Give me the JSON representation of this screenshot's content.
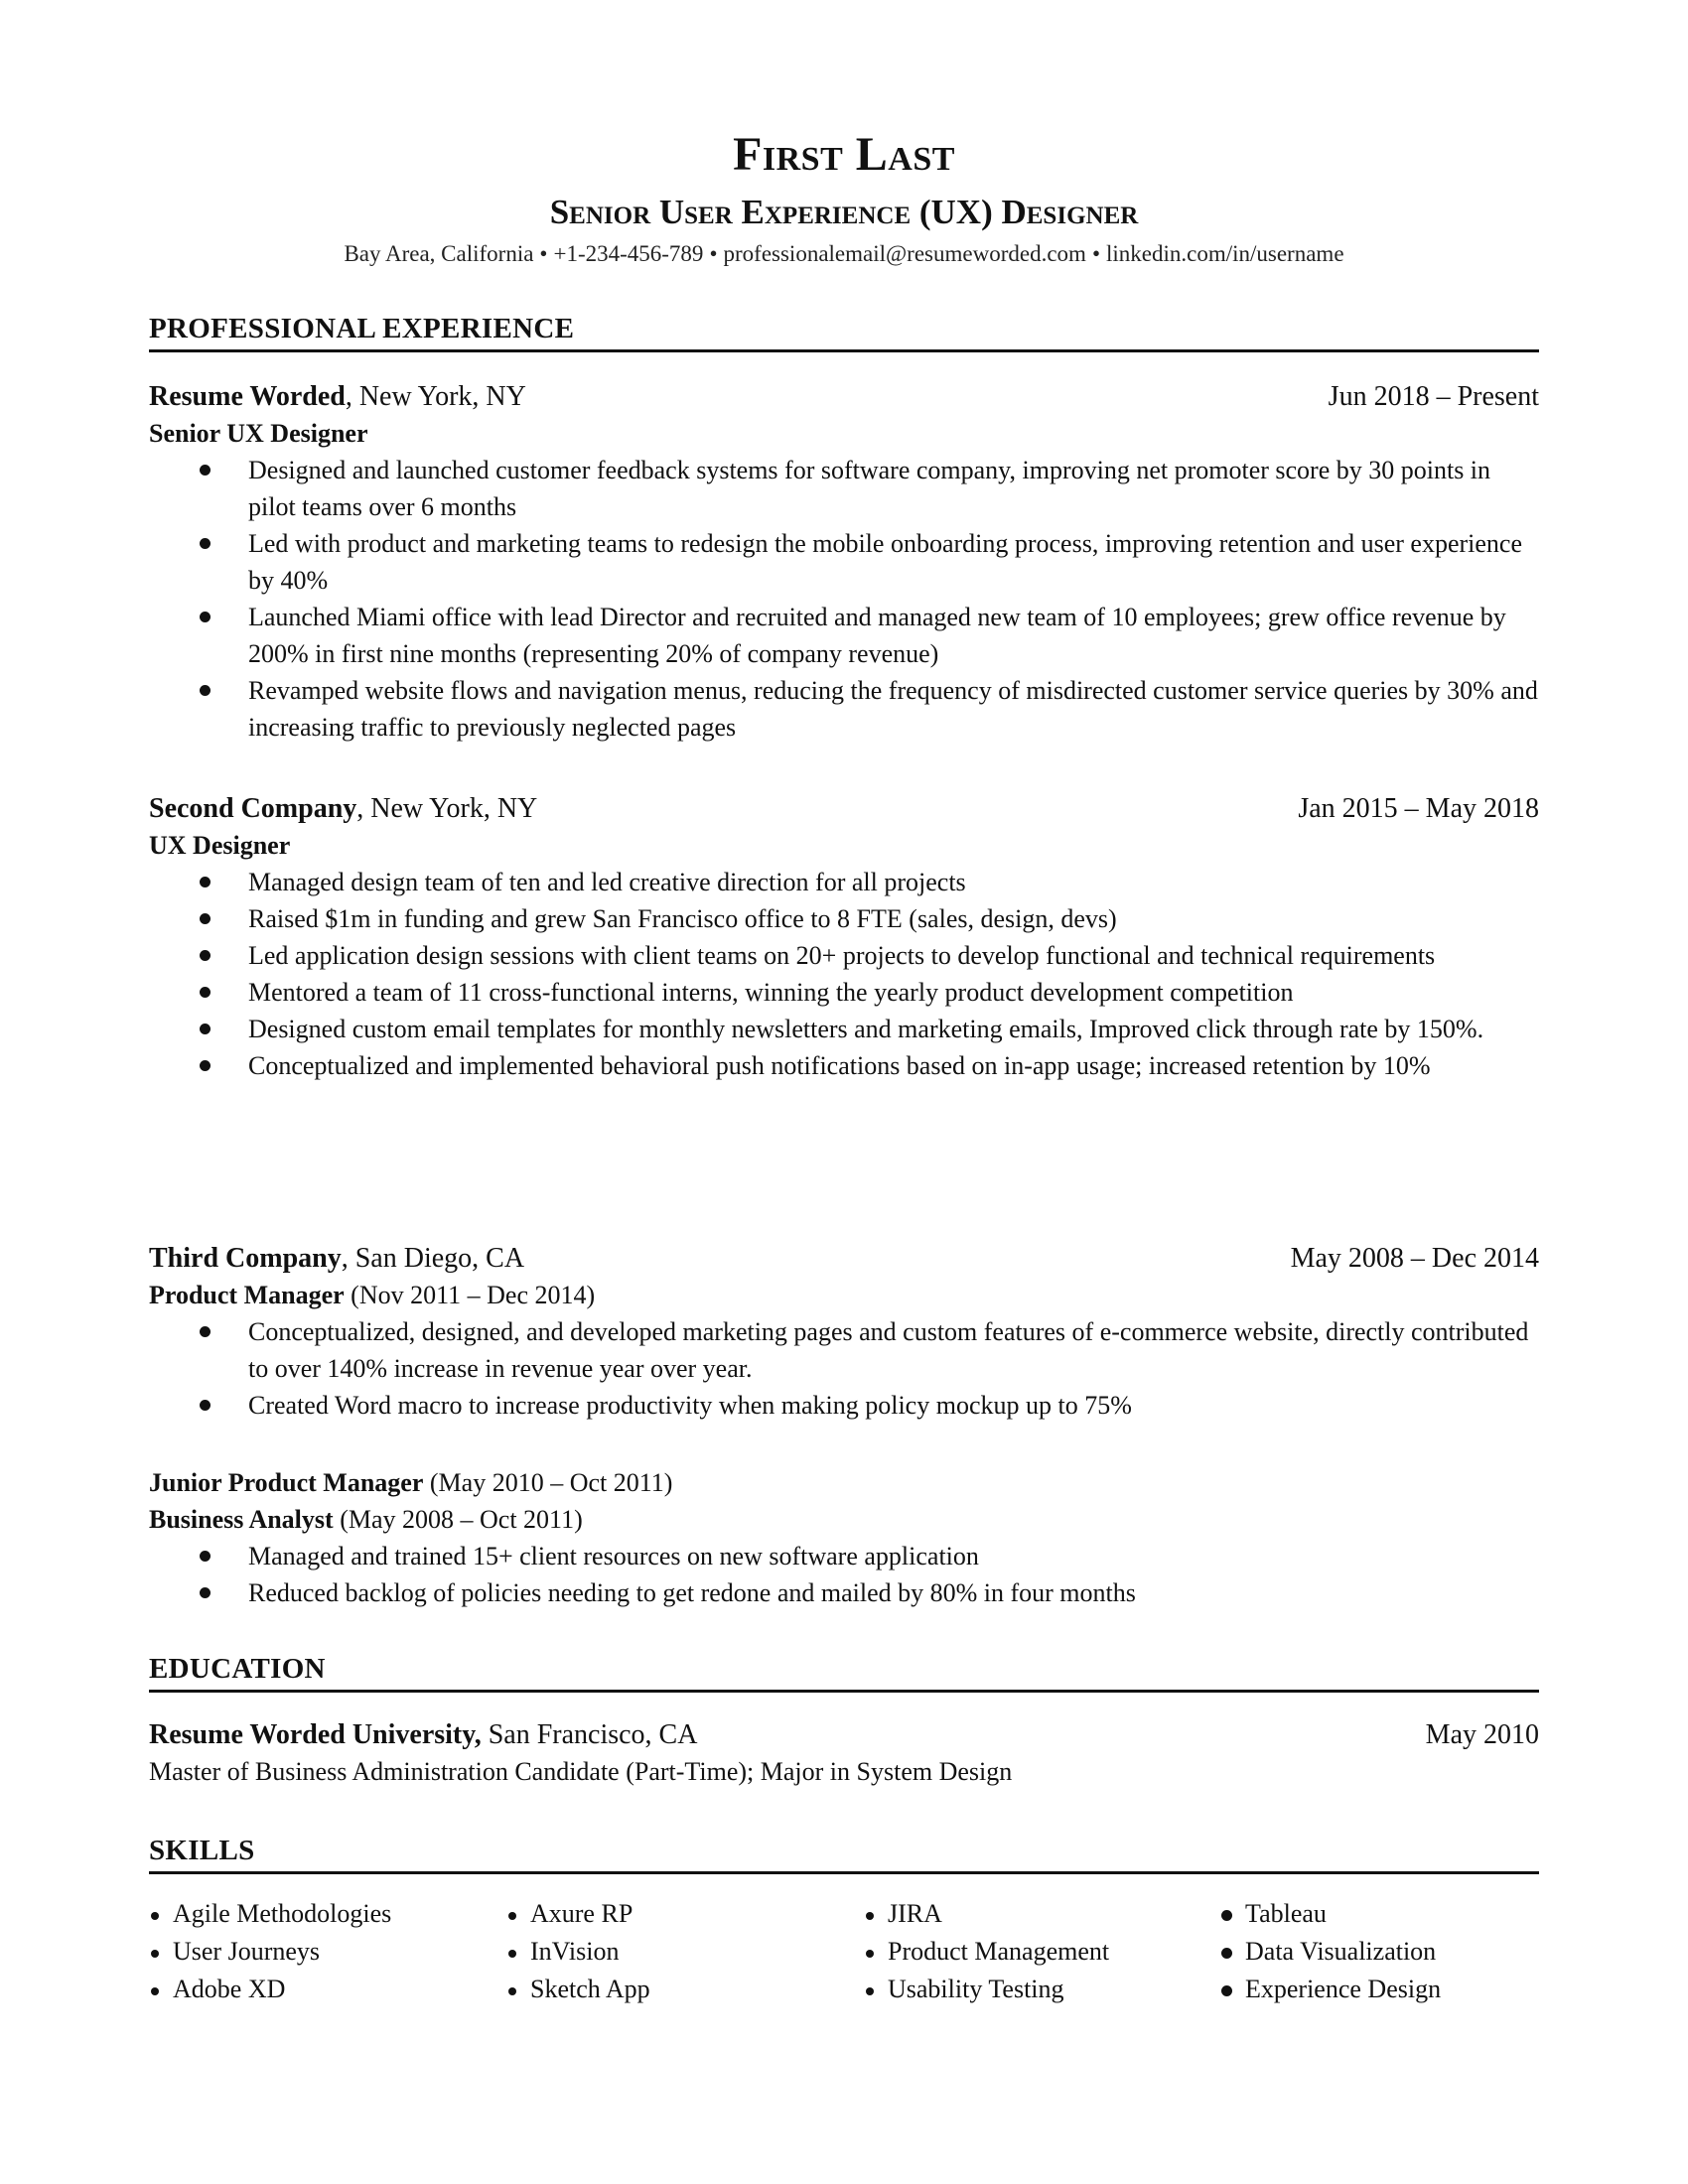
{
  "header": {
    "name": "First Last",
    "title": "Senior User Experience (UX) Designer",
    "contact": {
      "location": "Bay Area, California",
      "phone": "+1-234-456-789",
      "email": "professionalemail@resumeworded.com",
      "linkedin": "linkedin.com/in/username",
      "separator": "•"
    }
  },
  "experience": {
    "heading": "PROFESSIONAL EXPERIENCE",
    "jobs": [
      {
        "company": "Resume Worded",
        "location": ", New York, NY",
        "dates": "Jun 2018 – Present",
        "roles": [
          {
            "title": "Senior UX Designer",
            "dates": ""
          }
        ],
        "bullets": [
          "Designed and launched customer feedback systems for software company, improving net promoter score by 30 points in pilot teams over 6 months",
          "Led with product and marketing teams to redesign the mobile onboarding process, improving retention and user experience by 40%",
          "Launched Miami office with lead Director and recruited and managed new team of 10 employees; grew office revenue by 200% in first nine months (representing 20% of company revenue)",
          "Revamped website flows and navigation menus, reducing the frequency of misdirected customer service queries by 30% and increasing traffic to previously neglected pages"
        ]
      },
      {
        "company": "Second Company",
        "location": ", New York, NY",
        "dates": "Jan 2015 – May 2018",
        "roles": [
          {
            "title": "UX Designer",
            "dates": ""
          }
        ],
        "bullets": [
          "Managed design team of ten and led creative direction for all projects",
          "Raised $1m in funding and grew San Francisco office to 8 FTE (sales, design, devs)",
          "Led application design sessions with client teams on 20+ projects to develop functional and technical requirements",
          "Mentored a team of 11 cross-functional interns, winning the yearly product development competition",
          "Designed custom email templates for monthly newsletters and marketing emails, Improved click through rate by 150%.",
          "Conceptualized and implemented behavioral push notifications based on in-app usage; increased retention by 10%"
        ]
      },
      {
        "company": "Third Company",
        "location": ", San Diego, CA",
        "dates": "May 2008 – Dec 2014",
        "roles": [
          {
            "title": "Product Manager",
            "dates": " (Nov 2011 – Dec 2014)"
          }
        ],
        "bullets": [
          "Conceptualized, designed, and developed marketing pages and custom features of e-commerce website, directly contributed to over 140% increase in revenue year over year.",
          "Created Word macro to increase productivity when making policy mockup up to 75%"
        ],
        "sub_roles": [
          {
            "title": "Junior Product Manager",
            "dates": " (May 2010 – Oct 2011)"
          },
          {
            "title": "Business Analyst",
            "dates": " (May 2008 – Oct 2011)"
          }
        ],
        "sub_bullets": [
          "Managed and trained 15+ client resources on new software application",
          "Reduced backlog of policies needing to get redone and mailed by 80% in four months"
        ]
      }
    ]
  },
  "education": {
    "heading": "EDUCATION",
    "school": "Resume Worded University,",
    "location": " San Francisco, CA",
    "date": "May 2010",
    "degree": "Master of Business Administration Candidate (Part-Time); Major in System Design"
  },
  "skills": {
    "heading": "SKILLS",
    "columns": [
      [
        "Agile Methodologies",
        "User Journeys",
        "Adobe XD"
      ],
      [
        "Axure RP",
        "InVision",
        "Sketch App"
      ],
      [
        "JIRA",
        "Product Management",
        "Usability Testing"
      ],
      [
        "Tableau",
        "Data Visualization",
        "Experience Design"
      ]
    ]
  }
}
